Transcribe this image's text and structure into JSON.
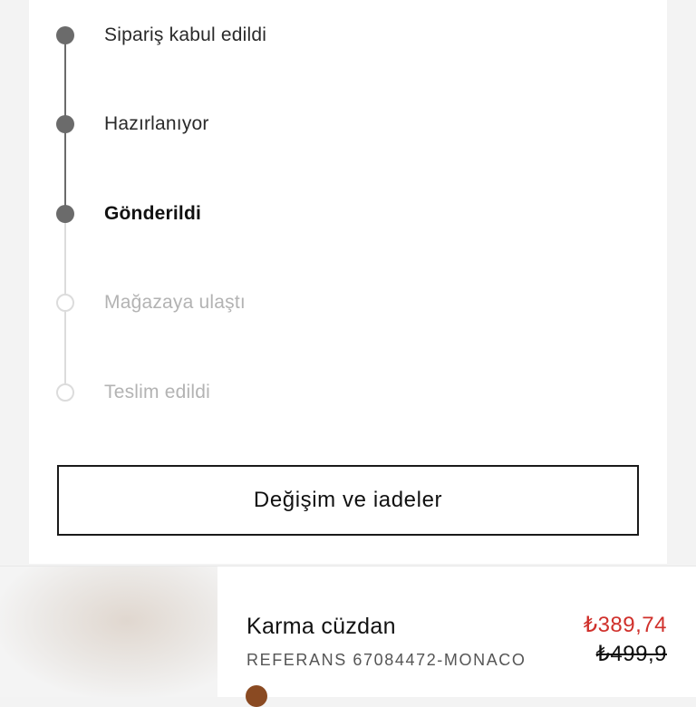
{
  "order_status": {
    "steps": [
      {
        "label": "Sipariş kabul edildi",
        "state": "done"
      },
      {
        "label": "Hazırlanıyor",
        "state": "done"
      },
      {
        "label": "Gönderildi",
        "state": "current"
      },
      {
        "label": "Mağazaya ulaştı",
        "state": "pending"
      },
      {
        "label": "Teslim edildi",
        "state": "pending"
      }
    ]
  },
  "actions": {
    "returns_label": "Değişim ve iadeler"
  },
  "product": {
    "name": "Karma cüzdan",
    "reference": "REFERANS 67084472-MONACO",
    "price_sale": "₺389,74",
    "price_original": "₺499,9",
    "colors": {
      "sale": "#d0302b",
      "swatch": "#8a4a22",
      "timeline_done": "#6b6b6b",
      "timeline_pending": "#dcdcdc"
    }
  }
}
